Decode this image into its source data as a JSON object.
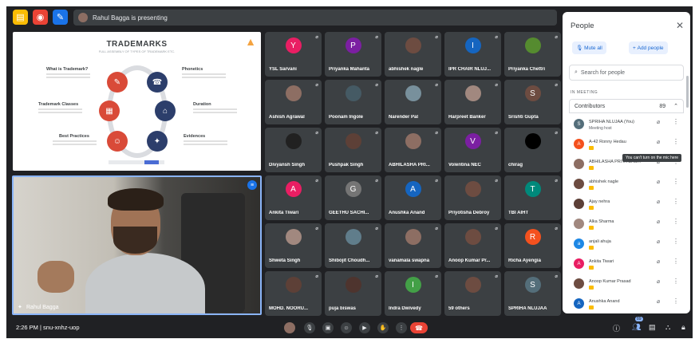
{
  "meeting": {
    "presenting_text": "Rahul Bagga is presenting",
    "time_code": "2:26 PM | snu-xnhz-uop"
  },
  "slide": {
    "title": "TRADEMARKS",
    "subtitle": "FULL ASSEMBLY OF TYPES OF TRADEMARK ETC.",
    "labels": [
      "What is Trademark?",
      "Phonetics",
      "Trademark Classes",
      "Duration",
      "Best Practices",
      "Evidences"
    ]
  },
  "speaker": {
    "name": "Rahul Bagga"
  },
  "tiles": [
    {
      "name": "YSL Sarvani",
      "initial": "Y",
      "color": "#e91e63"
    },
    {
      "name": "Priyanka Mahanta",
      "initial": "P",
      "color": "#7b1fa2"
    },
    {
      "name": "abhishek nagle",
      "initial": "",
      "color": "#6d4c41"
    },
    {
      "name": "IPR CHAIR NLUJ...",
      "initial": "I",
      "color": "#1565c0"
    },
    {
      "name": "Priyanka Chettri",
      "initial": "",
      "color": "#558b2f"
    },
    {
      "name": "Ashish Agrawal",
      "initial": "",
      "color": "#8d6e63"
    },
    {
      "name": "Poonam Ingole",
      "initial": "",
      "color": "#455a64"
    },
    {
      "name": "Narender Pal",
      "initial": "",
      "color": "#78909c"
    },
    {
      "name": "Harpreet Banker",
      "initial": "",
      "color": "#a1887f"
    },
    {
      "name": "Srishti Gupta",
      "initial": "S",
      "color": "#6d4c41"
    },
    {
      "name": "Divyansh Singh",
      "initial": "",
      "color": "#212121"
    },
    {
      "name": "Pushpak Singh",
      "initial": "",
      "color": "#5d4037"
    },
    {
      "name": "ABHILASHA PRI...",
      "initial": "",
      "color": "#8d6e63"
    },
    {
      "name": "Volentina NEC",
      "initial": "V",
      "color": "#7b1fa2"
    },
    {
      "name": "chirag",
      "initial": "",
      "color": "#000000"
    },
    {
      "name": "Ankita Tiwari",
      "initial": "A",
      "color": "#e91e63"
    },
    {
      "name": "GEETHU SACHI...",
      "initial": "G",
      "color": "#757575"
    },
    {
      "name": "Anushka Anand",
      "initial": "A",
      "color": "#1565c0"
    },
    {
      "name": "Priyotisha Debroy",
      "initial": "",
      "color": "#6d4c41"
    },
    {
      "name": "TBI AIHT",
      "initial": "T",
      "color": "#00897b"
    },
    {
      "name": "Shweta Singh",
      "initial": "",
      "color": "#a1887f"
    },
    {
      "name": "Shibojit Choudh...",
      "initial": "",
      "color": "#607d8b"
    },
    {
      "name": "vanamala swapna",
      "initial": "",
      "color": "#8d6e63"
    },
    {
      "name": "Anoop Kumar Pr...",
      "initial": "",
      "color": "#6d4c41"
    },
    {
      "name": "Richa Ayengia",
      "initial": "R",
      "color": "#f4511e"
    },
    {
      "name": "MOHD. NOORU...",
      "initial": "",
      "color": "#5d4037"
    },
    {
      "name": "puja biswas",
      "initial": "",
      "color": "#4e342e"
    },
    {
      "name": "Indra Dwivedy",
      "initial": "I",
      "color": "#43a047"
    },
    {
      "name": "59 others",
      "initial": "",
      "color": "#6d4c41"
    },
    {
      "name": "SPRIHA NLUJAA",
      "initial": "S",
      "color": "#546e7a"
    }
  ],
  "people_panel": {
    "title": "People",
    "mute_all": "Mute all",
    "add_people": "Add people",
    "search_placeholder": "Search for people",
    "in_meeting": "IN MEETING",
    "contributors_label": "Contributors",
    "contributors_count": "89",
    "tooltip": "You can't turn on the mic here",
    "people": [
      {
        "name": "SPRIHA NLUJAA (You)",
        "sub": "Meeting host",
        "initial": "S",
        "color": "#546e7a"
      },
      {
        "name": "A-42 Ronny Hedau",
        "sub": "",
        "initial": "A",
        "color": "#f4511e"
      },
      {
        "name": "ABHILASHA PRIYA DAS...",
        "sub": "",
        "initial": "",
        "color": "#8d6e63"
      },
      {
        "name": "abhishek nagle",
        "sub": "",
        "initial": "",
        "color": "#6d4c41"
      },
      {
        "name": "Ajay nehra",
        "sub": "",
        "initial": "",
        "color": "#5d4037"
      },
      {
        "name": "Alka Sharma",
        "sub": "",
        "initial": "",
        "color": "#a1887f"
      },
      {
        "name": "anjali ahuja",
        "sub": "",
        "initial": "a",
        "color": "#1e88e5"
      },
      {
        "name": "Ankita Tiwari",
        "sub": "",
        "initial": "A",
        "color": "#e91e63"
      },
      {
        "name": "Anoop Kumar Prasad",
        "sub": "",
        "initial": "",
        "color": "#6d4c41"
      },
      {
        "name": "Anushka Anand",
        "sub": "",
        "initial": "A",
        "color": "#1565c0"
      }
    ]
  },
  "controls": {
    "people_badge": "89"
  }
}
